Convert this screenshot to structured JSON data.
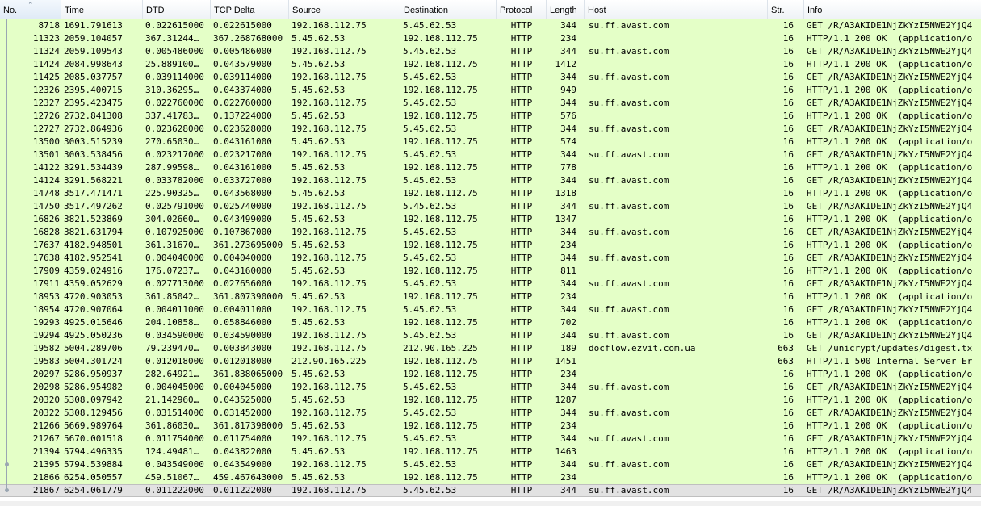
{
  "columns": [
    {
      "label": "No."
    },
    {
      "label": "Time"
    },
    {
      "label": "DTD"
    },
    {
      "label": "TCP Delta"
    },
    {
      "label": "Source"
    },
    {
      "label": "Destination"
    },
    {
      "label": "Protocol"
    },
    {
      "label": "Length"
    },
    {
      "label": "Host"
    },
    {
      "label": "Str."
    },
    {
      "label": "Info"
    }
  ],
  "sort_icon": "sort-up-icon",
  "colors": {
    "http_row": "#e4ffc7",
    "selected_row": "#e2e2e2"
  },
  "selected_index": 36,
  "rows": [
    {
      "no": "8718",
      "time": "1691.791613",
      "dtd": "0.022615000",
      "tcp": "0.022615000",
      "src": "192.168.112.75",
      "dst": "5.45.62.53",
      "proto": "HTTP",
      "len": "344",
      "host": "su.ff.avast.com",
      "str": "16",
      "info": "GET /R/A3AKIDE1NjZkYzI5NWE2YjQ4"
    },
    {
      "no": "11323",
      "time": "2059.104057",
      "dtd": "367.31244…",
      "tcp": "367.268768000",
      "src": "5.45.62.53",
      "dst": "192.168.112.75",
      "proto": "HTTP",
      "len": "234",
      "host": "",
      "str": "16",
      "info": "HTTP/1.1 200 OK  (application/o"
    },
    {
      "no": "11324",
      "time": "2059.109543",
      "dtd": "0.005486000",
      "tcp": "0.005486000",
      "src": "192.168.112.75",
      "dst": "5.45.62.53",
      "proto": "HTTP",
      "len": "344",
      "host": "su.ff.avast.com",
      "str": "16",
      "info": "GET /R/A3AKIDE1NjZkYzI5NWE2YjQ4"
    },
    {
      "no": "11424",
      "time": "2084.998643",
      "dtd": "25.889100…",
      "tcp": "0.043579000",
      "src": "5.45.62.53",
      "dst": "192.168.112.75",
      "proto": "HTTP",
      "len": "1412",
      "host": "",
      "str": "16",
      "info": "HTTP/1.1 200 OK  (application/o"
    },
    {
      "no": "11425",
      "time": "2085.037757",
      "dtd": "0.039114000",
      "tcp": "0.039114000",
      "src": "192.168.112.75",
      "dst": "5.45.62.53",
      "proto": "HTTP",
      "len": "344",
      "host": "su.ff.avast.com",
      "str": "16",
      "info": "GET /R/A3AKIDE1NjZkYzI5NWE2YjQ4"
    },
    {
      "no": "12326",
      "time": "2395.400715",
      "dtd": "310.36295…",
      "tcp": "0.043374000",
      "src": "5.45.62.53",
      "dst": "192.168.112.75",
      "proto": "HTTP",
      "len": "949",
      "host": "",
      "str": "16",
      "info": "HTTP/1.1 200 OK  (application/o"
    },
    {
      "no": "12327",
      "time": "2395.423475",
      "dtd": "0.022760000",
      "tcp": "0.022760000",
      "src": "192.168.112.75",
      "dst": "5.45.62.53",
      "proto": "HTTP",
      "len": "344",
      "host": "su.ff.avast.com",
      "str": "16",
      "info": "GET /R/A3AKIDE1NjZkYzI5NWE2YjQ4"
    },
    {
      "no": "12726",
      "time": "2732.841308",
      "dtd": "337.41783…",
      "tcp": "0.137224000",
      "src": "5.45.62.53",
      "dst": "192.168.112.75",
      "proto": "HTTP",
      "len": "576",
      "host": "",
      "str": "16",
      "info": "HTTP/1.1 200 OK  (application/o"
    },
    {
      "no": "12727",
      "time": "2732.864936",
      "dtd": "0.023628000",
      "tcp": "0.023628000",
      "src": "192.168.112.75",
      "dst": "5.45.62.53",
      "proto": "HTTP",
      "len": "344",
      "host": "su.ff.avast.com",
      "str": "16",
      "info": "GET /R/A3AKIDE1NjZkYzI5NWE2YjQ4"
    },
    {
      "no": "13500",
      "time": "3003.515239",
      "dtd": "270.65030…",
      "tcp": "0.043161000",
      "src": "5.45.62.53",
      "dst": "192.168.112.75",
      "proto": "HTTP",
      "len": "574",
      "host": "",
      "str": "16",
      "info": "HTTP/1.1 200 OK  (application/o"
    },
    {
      "no": "13501",
      "time": "3003.538456",
      "dtd": "0.023217000",
      "tcp": "0.023217000",
      "src": "192.168.112.75",
      "dst": "5.45.62.53",
      "proto": "HTTP",
      "len": "344",
      "host": "su.ff.avast.com",
      "str": "16",
      "info": "GET /R/A3AKIDE1NjZkYzI5NWE2YjQ4"
    },
    {
      "no": "14122",
      "time": "3291.534439",
      "dtd": "287.99598…",
      "tcp": "0.043161000",
      "src": "5.45.62.53",
      "dst": "192.168.112.75",
      "proto": "HTTP",
      "len": "778",
      "host": "",
      "str": "16",
      "info": "HTTP/1.1 200 OK  (application/o"
    },
    {
      "no": "14124",
      "time": "3291.568221",
      "dtd": "0.033782000",
      "tcp": "0.033727000",
      "src": "192.168.112.75",
      "dst": "5.45.62.53",
      "proto": "HTTP",
      "len": "344",
      "host": "su.ff.avast.com",
      "str": "16",
      "info": "GET /R/A3AKIDE1NjZkYzI5NWE2YjQ4"
    },
    {
      "no": "14748",
      "time": "3517.471471",
      "dtd": "225.90325…",
      "tcp": "0.043568000",
      "src": "5.45.62.53",
      "dst": "192.168.112.75",
      "proto": "HTTP",
      "len": "1318",
      "host": "",
      "str": "16",
      "info": "HTTP/1.1 200 OK  (application/o"
    },
    {
      "no": "14750",
      "time": "3517.497262",
      "dtd": "0.025791000",
      "tcp": "0.025740000",
      "src": "192.168.112.75",
      "dst": "5.45.62.53",
      "proto": "HTTP",
      "len": "344",
      "host": "su.ff.avast.com",
      "str": "16",
      "info": "GET /R/A3AKIDE1NjZkYzI5NWE2YjQ4"
    },
    {
      "no": "16826",
      "time": "3821.523869",
      "dtd": "304.02660…",
      "tcp": "0.043499000",
      "src": "5.45.62.53",
      "dst": "192.168.112.75",
      "proto": "HTTP",
      "len": "1347",
      "host": "",
      "str": "16",
      "info": "HTTP/1.1 200 OK  (application/o"
    },
    {
      "no": "16828",
      "time": "3821.631794",
      "dtd": "0.107925000",
      "tcp": "0.107867000",
      "src": "192.168.112.75",
      "dst": "5.45.62.53",
      "proto": "HTTP",
      "len": "344",
      "host": "su.ff.avast.com",
      "str": "16",
      "info": "GET /R/A3AKIDE1NjZkYzI5NWE2YjQ4"
    },
    {
      "no": "17637",
      "time": "4182.948501",
      "dtd": "361.31670…",
      "tcp": "361.273695000",
      "src": "5.45.62.53",
      "dst": "192.168.112.75",
      "proto": "HTTP",
      "len": "234",
      "host": "",
      "str": "16",
      "info": "HTTP/1.1 200 OK  (application/o"
    },
    {
      "no": "17638",
      "time": "4182.952541",
      "dtd": "0.004040000",
      "tcp": "0.004040000",
      "src": "192.168.112.75",
      "dst": "5.45.62.53",
      "proto": "HTTP",
      "len": "344",
      "host": "su.ff.avast.com",
      "str": "16",
      "info": "GET /R/A3AKIDE1NjZkYzI5NWE2YjQ4"
    },
    {
      "no": "17909",
      "time": "4359.024916",
      "dtd": "176.07237…",
      "tcp": "0.043160000",
      "src": "5.45.62.53",
      "dst": "192.168.112.75",
      "proto": "HTTP",
      "len": "811",
      "host": "",
      "str": "16",
      "info": "HTTP/1.1 200 OK  (application/o"
    },
    {
      "no": "17911",
      "time": "4359.052629",
      "dtd": "0.027713000",
      "tcp": "0.027656000",
      "src": "192.168.112.75",
      "dst": "5.45.62.53",
      "proto": "HTTP",
      "len": "344",
      "host": "su.ff.avast.com",
      "str": "16",
      "info": "GET /R/A3AKIDE1NjZkYzI5NWE2YjQ4"
    },
    {
      "no": "18953",
      "time": "4720.903053",
      "dtd": "361.85042…",
      "tcp": "361.807390000",
      "src": "5.45.62.53",
      "dst": "192.168.112.75",
      "proto": "HTTP",
      "len": "234",
      "host": "",
      "str": "16",
      "info": "HTTP/1.1 200 OK  (application/o"
    },
    {
      "no": "18954",
      "time": "4720.907064",
      "dtd": "0.004011000",
      "tcp": "0.004011000",
      "src": "192.168.112.75",
      "dst": "5.45.62.53",
      "proto": "HTTP",
      "len": "344",
      "host": "su.ff.avast.com",
      "str": "16",
      "info": "GET /R/A3AKIDE1NjZkYzI5NWE2YjQ4"
    },
    {
      "no": "19293",
      "time": "4925.015646",
      "dtd": "204.10858…",
      "tcp": "0.058846000",
      "src": "5.45.62.53",
      "dst": "192.168.112.75",
      "proto": "HTTP",
      "len": "702",
      "host": "",
      "str": "16",
      "info": "HTTP/1.1 200 OK  (application/o"
    },
    {
      "no": "19294",
      "time": "4925.050236",
      "dtd": "0.034590000",
      "tcp": "0.034590000",
      "src": "192.168.112.75",
      "dst": "5.45.62.53",
      "proto": "HTTP",
      "len": "344",
      "host": "su.ff.avast.com",
      "str": "16",
      "info": "GET /R/A3AKIDE1NjZkYzI5NWE2YjQ4"
    },
    {
      "no": "19582",
      "time": "5004.289706",
      "dtd": "79.239470…",
      "tcp": "0.003843000",
      "src": "192.168.112.75",
      "dst": "212.90.165.225",
      "proto": "HTTP",
      "len": "189",
      "host": "docflow.ezvit.com.ua",
      "str": "663",
      "info": "GET /unicrypt/updates/digest.tx"
    },
    {
      "no": "19583",
      "time": "5004.301724",
      "dtd": "0.012018000",
      "tcp": "0.012018000",
      "src": "212.90.165.225",
      "dst": "192.168.112.75",
      "proto": "HTTP",
      "len": "1451",
      "host": "",
      "str": "663",
      "info": "HTTP/1.1 500 Internal Server Er"
    },
    {
      "no": "20297",
      "time": "5286.950937",
      "dtd": "282.64921…",
      "tcp": "361.838065000",
      "src": "5.45.62.53",
      "dst": "192.168.112.75",
      "proto": "HTTP",
      "len": "234",
      "host": "",
      "str": "16",
      "info": "HTTP/1.1 200 OK  (application/o"
    },
    {
      "no": "20298",
      "time": "5286.954982",
      "dtd": "0.004045000",
      "tcp": "0.004045000",
      "src": "192.168.112.75",
      "dst": "5.45.62.53",
      "proto": "HTTP",
      "len": "344",
      "host": "su.ff.avast.com",
      "str": "16",
      "info": "GET /R/A3AKIDE1NjZkYzI5NWE2YjQ4"
    },
    {
      "no": "20320",
      "time": "5308.097942",
      "dtd": "21.142960…",
      "tcp": "0.043525000",
      "src": "5.45.62.53",
      "dst": "192.168.112.75",
      "proto": "HTTP",
      "len": "1287",
      "host": "",
      "str": "16",
      "info": "HTTP/1.1 200 OK  (application/o"
    },
    {
      "no": "20322",
      "time": "5308.129456",
      "dtd": "0.031514000",
      "tcp": "0.031452000",
      "src": "192.168.112.75",
      "dst": "5.45.62.53",
      "proto": "HTTP",
      "len": "344",
      "host": "su.ff.avast.com",
      "str": "16",
      "info": "GET /R/A3AKIDE1NjZkYzI5NWE2YjQ4"
    },
    {
      "no": "21266",
      "time": "5669.989764",
      "dtd": "361.86030…",
      "tcp": "361.817398000",
      "src": "5.45.62.53",
      "dst": "192.168.112.75",
      "proto": "HTTP",
      "len": "234",
      "host": "",
      "str": "16",
      "info": "HTTP/1.1 200 OK  (application/o"
    },
    {
      "no": "21267",
      "time": "5670.001518",
      "dtd": "0.011754000",
      "tcp": "0.011754000",
      "src": "192.168.112.75",
      "dst": "5.45.62.53",
      "proto": "HTTP",
      "len": "344",
      "host": "su.ff.avast.com",
      "str": "16",
      "info": "GET /R/A3AKIDE1NjZkYzI5NWE2YjQ4"
    },
    {
      "no": "21394",
      "time": "5794.496335",
      "dtd": "124.49481…",
      "tcp": "0.043822000",
      "src": "5.45.62.53",
      "dst": "192.168.112.75",
      "proto": "HTTP",
      "len": "1463",
      "host": "",
      "str": "16",
      "info": "HTTP/1.1 200 OK  (application/o"
    },
    {
      "no": "21395",
      "time": "5794.539884",
      "dtd": "0.043549000",
      "tcp": "0.043549000",
      "src": "192.168.112.75",
      "dst": "5.45.62.53",
      "proto": "HTTP",
      "len": "344",
      "host": "su.ff.avast.com",
      "str": "16",
      "info": "GET /R/A3AKIDE1NjZkYzI5NWE2YjQ4"
    },
    {
      "no": "21866",
      "time": "6254.050557",
      "dtd": "459.51067…",
      "tcp": "459.467643000",
      "src": "5.45.62.53",
      "dst": "192.168.112.75",
      "proto": "HTTP",
      "len": "234",
      "host": "",
      "str": "16",
      "info": "HTTP/1.1 200 OK  (application/o"
    },
    {
      "no": "21867",
      "time": "6254.061779",
      "dtd": "0.011222000",
      "tcp": "0.011222000",
      "src": "192.168.112.75",
      "dst": "5.45.62.53",
      "proto": "HTTP",
      "len": "344",
      "host": "su.ff.avast.com",
      "str": "16",
      "info": "GET /R/A3AKIDE1NjZkYzI5NWE2YjQ4"
    }
  ]
}
